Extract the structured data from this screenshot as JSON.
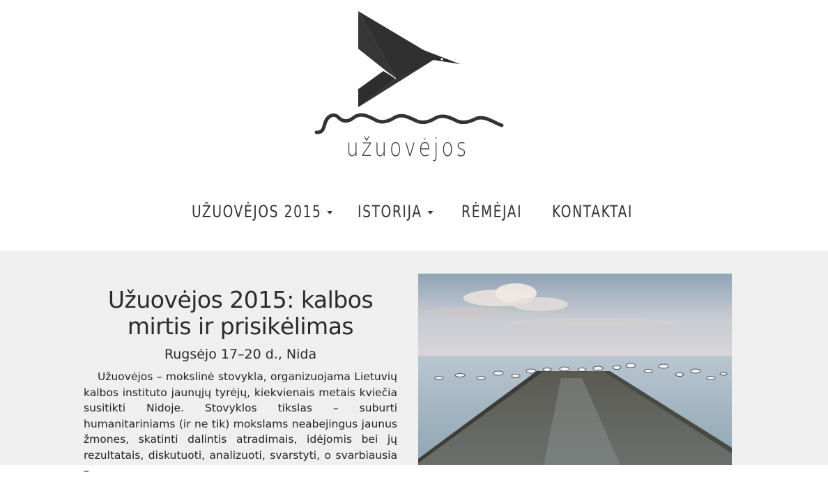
{
  "logo": {
    "text": "užuovėjos",
    "icon": "origami-bird-over-waves-icon"
  },
  "nav": {
    "items": [
      {
        "label": "UŽUOVĖJOS 2015",
        "dropdown": true
      },
      {
        "label": "ISTORIJA",
        "dropdown": true
      },
      {
        "label": "RĖMĖJAI",
        "dropdown": false
      },
      {
        "label": "KONTAKTAI",
        "dropdown": false
      }
    ]
  },
  "article": {
    "title_line1": "Užuovėjos 2015: kalbos",
    "title_line2": "mirtis ir prisikėlimas",
    "subtitle": "Rugsėjo 17–20 d., Nida",
    "lead": "Užuovėjos",
    "body": " – mokslinė stovykla, organizuojama Lietuvių kalbos instituto jaunųjų tyrėjų, kiekvienais metais kviečia susitikti Nidoje. Stovyklos tikslas – suburti humanitariniams (ir ne tik) mokslams neabejingus jaunus žmones, skatinti dalintis atradimais, idėjomis bei jų rezultatais, diskutuoti, analizuoti, svarstyti, o svarbiausia –"
  },
  "photo": {
    "subject": "pier-with-seagulls-photo"
  },
  "colors": {
    "background": "#ffffff",
    "content_bg": "#efefef",
    "text": "#222222",
    "logo": "#333333"
  }
}
